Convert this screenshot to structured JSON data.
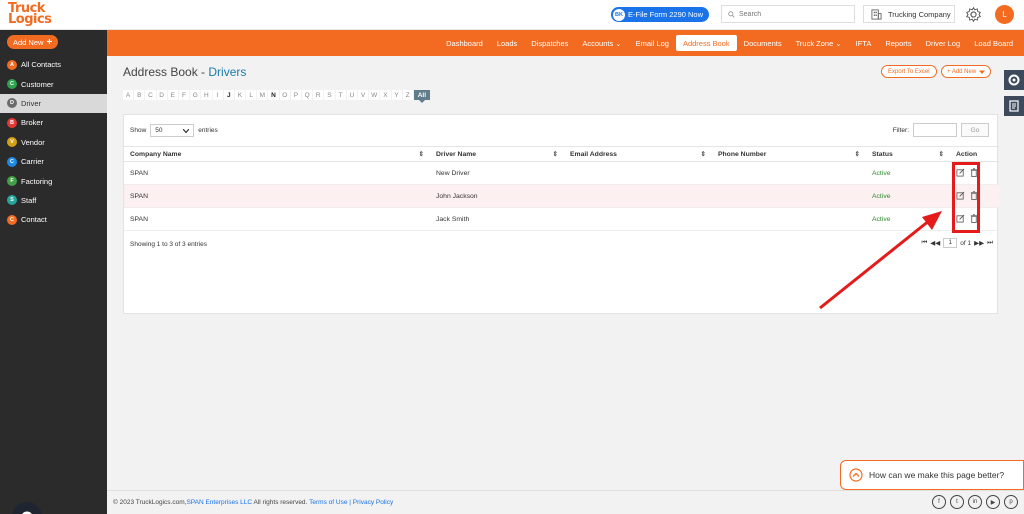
{
  "brand": {
    "logo_line1": "Truck",
    "logo_line2": "Logics",
    "accent": "#f26b21"
  },
  "header": {
    "efile_badge": "BK",
    "efile_label": "E-File Form 2290 Now",
    "search_placeholder": "Search",
    "company_name": "Trucking Company",
    "avatar_initial": "L"
  },
  "nav": {
    "items": [
      {
        "label": "Dashboard"
      },
      {
        "label": "Loads"
      },
      {
        "label": "Dispatches"
      },
      {
        "label": "Accounts ⌄"
      },
      {
        "label": "Email Log"
      },
      {
        "label": "Address Book",
        "active": true
      },
      {
        "label": "Documents"
      },
      {
        "label": "Truck Zone ⌄"
      },
      {
        "label": "IFTA"
      },
      {
        "label": "Reports"
      },
      {
        "label": "Driver Log"
      },
      {
        "label": "Load Board"
      }
    ]
  },
  "sidebar": {
    "add_new": "Add New",
    "items": [
      {
        "letter": "A",
        "label": "All Contacts",
        "color": "#f26b21"
      },
      {
        "letter": "C",
        "label": "Customer",
        "color": "#2ea44f"
      },
      {
        "letter": "D",
        "label": "Driver",
        "color": "#6b6b6b",
        "active": true
      },
      {
        "letter": "B",
        "label": "Broker",
        "color": "#e53935"
      },
      {
        "letter": "V",
        "label": "Vendor",
        "color": "#d4a017"
      },
      {
        "letter": "C",
        "label": "Carrier",
        "color": "#1e88e5"
      },
      {
        "letter": "F",
        "label": "Factoring",
        "color": "#43a047"
      },
      {
        "letter": "S",
        "label": "Staff",
        "color": "#26a69a"
      },
      {
        "letter": "C",
        "label": "Contact",
        "color": "#f26b21"
      }
    ]
  },
  "page": {
    "title": "Address Book - ",
    "title_accent": "Drivers",
    "export_label": "Export To Excel",
    "add_new_label": "+ Add New",
    "letters": [
      "A",
      "B",
      "C",
      "D",
      "E",
      "F",
      "G",
      "H",
      "I",
      "J",
      "K",
      "L",
      "M",
      "N",
      "O",
      "P",
      "Q",
      "R",
      "S",
      "T",
      "U",
      "V",
      "W",
      "X",
      "Y",
      "Z"
    ],
    "bold_letters": [
      "J",
      "N"
    ],
    "all_label": "All"
  },
  "table": {
    "show_label": "Show",
    "show_value": "50",
    "entries_label": "entries",
    "filter_label": "Filter:",
    "go_label": "Go",
    "columns": [
      "Company Name",
      "Driver Name",
      "Email Address",
      "Phone Number",
      "Status",
      "Action"
    ],
    "rows": [
      {
        "company": "SPAN",
        "driver": "New Driver",
        "email": "",
        "phone": "",
        "status": "Active"
      },
      {
        "company": "SPAN",
        "driver": "John Jackson",
        "email": "",
        "phone": "",
        "status": "Active"
      },
      {
        "company": "SPAN",
        "driver": "Jack Smith",
        "email": "",
        "phone": "",
        "status": "Active"
      }
    ],
    "showing_text": "Showing 1 to 3 of 3 entries",
    "page_value": "1",
    "page_total": "of 1"
  },
  "feedback": {
    "label": "How can we make this page better?"
  },
  "footer": {
    "copyright": "© 2023 TruckLogics.com, ",
    "company_link": "SPAN Enterprises LLC",
    "rights": " All rights reserved. ",
    "terms": "Terms of Use",
    "sep": " | ",
    "privacy": "Privacy Policy",
    "social": [
      "f",
      "t",
      "in",
      "▶",
      "p"
    ]
  }
}
